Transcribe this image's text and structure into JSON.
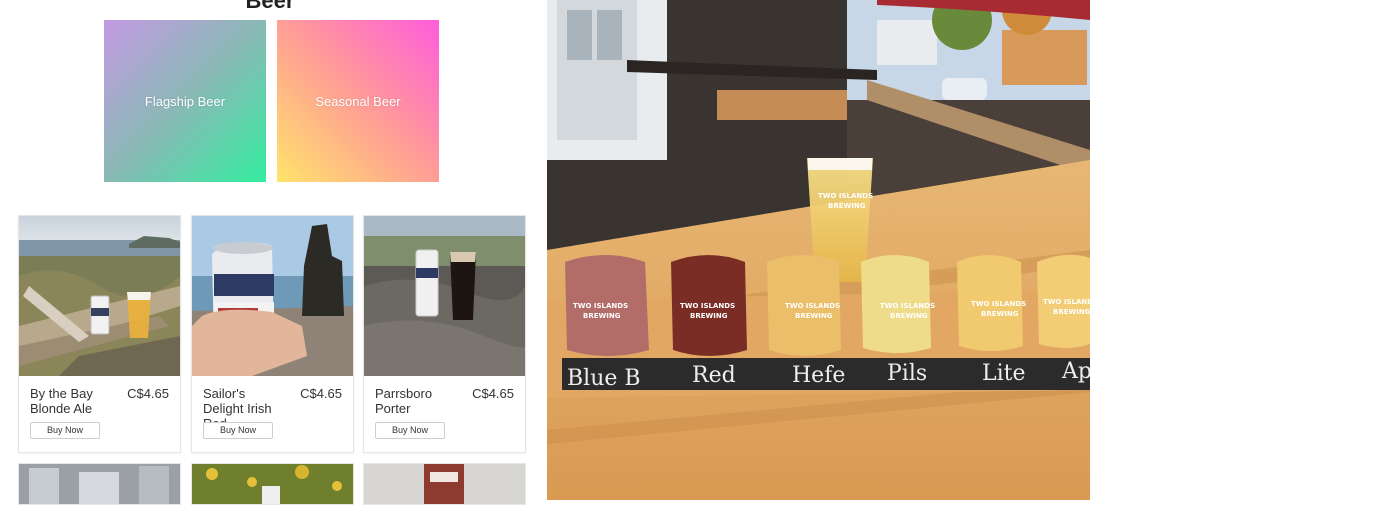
{
  "section": {
    "title": "Beer"
  },
  "categories": [
    {
      "label": "Flagship Beer"
    },
    {
      "label": "Seasonal Beer"
    }
  ],
  "products": [
    {
      "name": "By the Bay Blonde Ale",
      "price": "C$4.65",
      "button": "Buy Now",
      "image": "beach-driftwood-can-and-pint"
    },
    {
      "name": "Sailor's Delight Irish Red",
      "price": "C$4.65",
      "button": "Buy Now",
      "image": "hand-holding-can-by-sea-stack"
    },
    {
      "name": "Parrsboro Porter",
      "price": "C$4.65",
      "button": "Buy Now",
      "image": "can-and-dark-pint-on-rock"
    }
  ],
  "more_products": [
    {
      "image": "brewery-tanks"
    },
    {
      "image": "wildflowers-can"
    },
    {
      "image": "brewery-sign"
    }
  ],
  "hero": {
    "image": "beer-flight-on-patio-table",
    "chalk_labels": [
      "Blue B",
      "Red",
      "Hefe",
      "Pils",
      "Lite",
      "Ap"
    ],
    "glass_logo": [
      "TWO ISLANDS",
      "BREWING"
    ]
  },
  "colors": {
    "flagship_gradient": [
      "#c39ae3",
      "#33ed9f"
    ],
    "seasonal_gradient": [
      "#ff5cdc",
      "#ffe46b"
    ]
  }
}
